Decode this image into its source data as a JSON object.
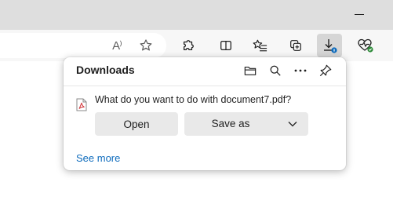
{
  "browser": {
    "icons": {
      "minimize": "minimize-icon",
      "read_aloud": "read-aloud-icon",
      "favorite": "star-icon",
      "extensions": "puzzle-icon",
      "split_screen": "split-screen-icon",
      "favorites": "favorites-icon",
      "collections": "collections-icon",
      "downloads": "download-icon",
      "performance": "heart-pulse-icon"
    },
    "read_aloud_label": "A⁾"
  },
  "downloads_panel": {
    "title": "Downloads",
    "icons": [
      "folder-icon",
      "search-icon",
      "more-icon",
      "pin-icon"
    ],
    "file_icon": "pdf-file-icon",
    "prompt": "What do you want to do with document7.pdf?",
    "open_label": "Open",
    "save_as_label": "Save as",
    "see_more_label": "See more"
  },
  "colors": {
    "link": "#0f6cbd",
    "badge": "#0f6cbd",
    "performance_check": "#2e8b3a",
    "pdf_red": "#d13438"
  }
}
